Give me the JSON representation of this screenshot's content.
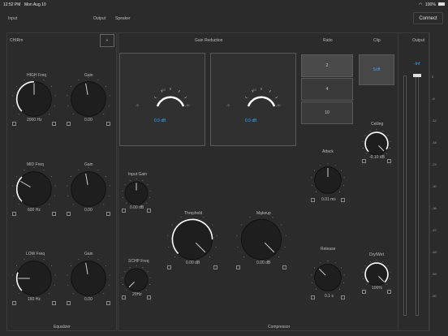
{
  "status_bar": {
    "time": "12:52 PM",
    "date": "Mon Aug 10",
    "battery": "100%",
    "wifi_icon": "wifi-icon",
    "battery_icon": "battery-icon"
  },
  "top_nav": {
    "input": "Input",
    "output": "Output",
    "speaker": "Speaker",
    "connect": "Connect"
  },
  "equalizer": {
    "title": "Equalizer",
    "cutoff_label": "CHIRm",
    "cutoff_toggle": "+",
    "bands": [
      {
        "freq_label": "HIGH Freq",
        "freq_value": "2000 Hz",
        "gain_label": "Gain",
        "gain_value": "0.00"
      },
      {
        "freq_label": "MID Freq",
        "freq_value": "600 Hz",
        "gain_label": "Gain",
        "gain_value": "0.00"
      },
      {
        "freq_label": "LOW Freq",
        "freq_value": "160 Hz",
        "gain_label": "Gain",
        "gain_value": "0.00"
      }
    ]
  },
  "compressor": {
    "title": "Compressor",
    "gain_reduction_label": "Gain Reduction",
    "meters": [
      {
        "value": "0.0 dB",
        "scale": [
          "-5",
          "-10",
          "-15",
          "-20"
        ]
      },
      {
        "value": "0.0 dB",
        "scale": [
          "-5",
          "-10",
          "-15",
          "-20"
        ]
      }
    ],
    "input_gain": {
      "label": "Input Gain",
      "value": "0.00 dB"
    },
    "schp_freq": {
      "label": "SCHP Freq",
      "value": "20Hz"
    },
    "threshold": {
      "label": "Threshold",
      "value": "0.00 dB"
    },
    "makeup": {
      "label": "Makeup",
      "value": "0.00 dB"
    },
    "ratio": {
      "label": "Ratio",
      "options": [
        "2",
        "4",
        "10"
      ],
      "selected": "2"
    },
    "clip": {
      "label": "Clip",
      "value": "Soft"
    },
    "ceiling": {
      "label": "Ceiling",
      "value": "-0.10 dB"
    },
    "attack": {
      "label": "Attack",
      "value": "0.01 ms"
    },
    "release": {
      "label": "Release",
      "value": "0.1 s"
    },
    "dry_wet": {
      "label": "Dry/Wet",
      "value": "100%"
    }
  },
  "output": {
    "label": "Output",
    "readout": "-Inf",
    "scale": [
      "0",
      "-6",
      "-12",
      "-18",
      "-24",
      "-30",
      "-36",
      "-42",
      "-48",
      "-54",
      "-60"
    ]
  },
  "colors": {
    "background": "#2b2b2b",
    "accent": "#4aa3ff",
    "knob_track": "#ffffff"
  }
}
